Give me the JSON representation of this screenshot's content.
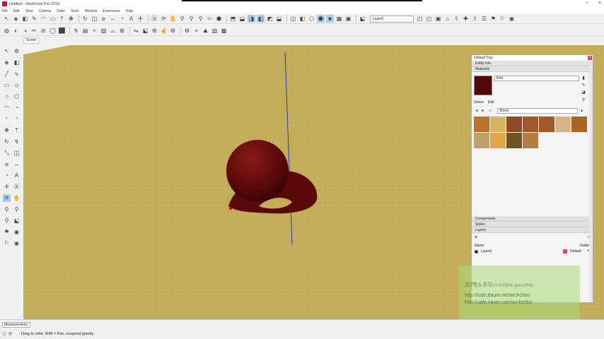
{
  "window": {
    "title": "Untitled - SketchUp Pro 2016"
  },
  "menu": [
    "File",
    "Edit",
    "View",
    "Camera",
    "Draw",
    "Tools",
    "Window",
    "Extensions",
    "Help"
  ],
  "toolbar1_icons": [
    "select-icon",
    "paint-bucket-icon",
    "eraser-icon",
    "pencil-icon",
    "arc-icon",
    "rectangle-icon",
    "push-pull-icon",
    "move-icon",
    "rotate-icon",
    "offset-icon",
    "tape-measure-icon",
    "dimension-icon",
    "protractor-icon",
    "text-icon",
    "axes-icon",
    "3d-text-icon",
    "orbit-icon",
    "pan-icon",
    "zoom-icon",
    "zoom-window-icon",
    "zoom-extents-icon",
    "previous-view-icon",
    "iso-view-icon",
    "top-view-icon",
    "front-view-icon",
    "right-view-icon",
    "back-view-icon",
    "left-view-icon",
    "bottom-view-icon",
    "xray-icon",
    "back-edges-icon",
    "wireframe-icon",
    "hidden-line-icon",
    "shaded-icon",
    "textured-icon",
    "monochrome-icon",
    "section-plane-icon",
    "display-section-icon",
    "display-cuts-icon",
    "components-icon",
    "warehouse-icon",
    "share-model-icon",
    "extension-warehouse-icon",
    "share-component-icon",
    "layers-icon",
    "walk-icon",
    "position-camera-icon",
    "look-around-icon"
  ],
  "toolbar1_selected": [
    25,
    26,
    32,
    33
  ],
  "layer_select": "Layer0",
  "toolbar2_icons": [
    "union-icon",
    "intersect-icon",
    "subtract-icon",
    "trim-icon",
    "split-icon",
    "outer-shell-icon",
    "solid-tools-icon",
    "follow-me-icon",
    "sandbox-icon",
    "smoove-icon",
    "stamp-icon",
    "drape-icon",
    "add-detail-icon",
    "flip-edge-icon",
    "section-icon",
    "dynamic-component-icon",
    "interact-icon",
    "component-options-icon",
    "component-attributes-icon",
    "location-icon",
    "terrain-icon",
    "photo-texture-icon",
    "match-photo-icon"
  ],
  "tab": "Scene",
  "left_tools": [
    [
      "select-icon",
      "component-icon"
    ],
    [
      "paint-icon",
      "eraser-icon"
    ],
    [
      "line-icon",
      "freehand-icon"
    ],
    [
      "rectangle-icon",
      "rotated-rect-icon"
    ],
    [
      "circle-icon",
      "polygon-icon"
    ],
    [
      "arc-icon",
      "pie-icon"
    ],
    [
      "three-point-arc-icon",
      "two-point-arc-icon"
    ],
    [
      "move-icon",
      "push-pull-icon"
    ],
    [
      "rotate-icon",
      "follow-me-icon"
    ],
    [
      "scale-icon",
      "offset-icon"
    ],
    [
      "tape-icon",
      "dimension-icon"
    ],
    [
      "protractor-icon",
      "text-icon"
    ],
    [
      "axes-icon",
      "3d-text-icon"
    ],
    [
      "orbit-icon",
      "pan-icon"
    ],
    [
      "zoom-icon",
      "zoom-window-icon"
    ],
    [
      "zoom-extents-icon",
      "section-plane-icon"
    ],
    [
      "walk-icon",
      "look-around-icon"
    ],
    [
      "position-camera-icon",
      "look-icon"
    ]
  ],
  "left_tools_selected": [
    13
  ],
  "panel": {
    "title": "Default Tray",
    "sections_top": [
      "Entity Info",
      "Materials"
    ],
    "material_name": "Red",
    "material_color": "#550606",
    "tabs": [
      "Select",
      "Edit"
    ],
    "library": "Wood",
    "swatches": [
      "#b9712c",
      "#d9b462",
      "#8d4a23",
      "#9c5a2c",
      "#a0592a",
      "#d6b58a",
      "#a96622",
      "#c2a06a",
      "#e0a449",
      "#6e5425",
      "#b57c42"
    ],
    "sections_bottom": [
      "Components",
      "Styles",
      "Layers"
    ],
    "layers_header": {
      "name": "Name",
      "visible": "Visible"
    },
    "layers": [
      {
        "name": "Layer0",
        "visible": "Default"
      }
    ]
  },
  "watermark": {
    "line1": "3D액스추부",
    "line1_sub": "(구.아키추부,3DCG추부)",
    "url1": "http://cafe.daum.net/archchbo",
    "url2": "http://cafe.naver.com/archchbo"
  },
  "status": {
    "measurements_label": "Measurements",
    "hint": "Drag to orbit. Shift = Pan, suspend gravity."
  }
}
